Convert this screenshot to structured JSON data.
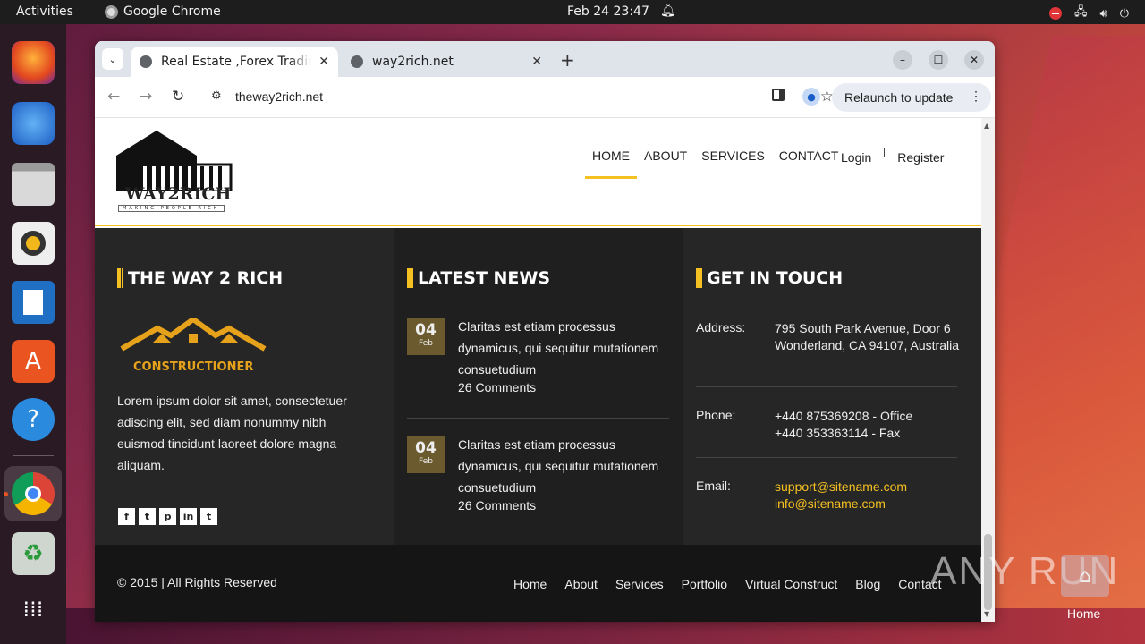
{
  "topbar": {
    "activities": "Activities",
    "app_name": "Google Chrome",
    "clock": "Feb 24  23:47"
  },
  "dock": {
    "items": [
      "firefox-icon",
      "thunderbird-icon",
      "files-icon",
      "rhythmbox-icon",
      "writer-icon",
      "app-center-icon",
      "help-icon",
      "chrome-icon",
      "trash-icon",
      "apps-grid-icon"
    ]
  },
  "browser": {
    "tabs": [
      {
        "title": "Real Estate ,Forex Trading",
        "active": true
      },
      {
        "title": "way2rich.net",
        "active": false
      }
    ],
    "url": "theway2rich.net",
    "relaunch_label": "Relaunch to update"
  },
  "site": {
    "logo_text": "WAY2RICH",
    "logo_tagline": "MAKING PEOPLE RICH",
    "nav": [
      {
        "label": "HOME",
        "active": true
      },
      {
        "label": "ABOUT",
        "active": false
      },
      {
        "label": "SERVICES",
        "active": false
      },
      {
        "label": "CONTACT",
        "active": false
      }
    ],
    "login": "Login",
    "register": "Register",
    "accent_color": "#f5c021"
  },
  "footer": {
    "col1": {
      "title": "THE WAY 2 RICH",
      "logo_name": "CONSTRUCTIONER",
      "text": "Lorem ipsum dolor sit amet, consectetuer adiscing elit, sed diam nonummy nibh euismod tincidunt laoreet dolore magna aliquam.",
      "socials": [
        "f",
        "t",
        "p",
        "in",
        "t"
      ]
    },
    "col2": {
      "title": "LATEST NEWS",
      "items": [
        {
          "day": "04",
          "month": "Feb",
          "text": "Claritas est etiam processus dynamicus, qui sequitur mutationem consuetudium",
          "comments": "26 Comments"
        },
        {
          "day": "04",
          "month": "Feb",
          "text": "Claritas est etiam processus dynamicus, qui sequitur mutationem consuetudium",
          "comments": "26 Comments"
        }
      ]
    },
    "col3": {
      "title": "GET IN TOUCH",
      "address_label": "Address:",
      "address": "795 South Park Avenue, Door 6 Wonderland, CA 94107, Australia",
      "phone_label": "Phone:",
      "phone_office": "+440 875369208 - Office",
      "phone_fax": "+440 353363114 - Fax",
      "email_label": "Email:",
      "email1": "support@sitename.com",
      "email2": "info@sitename.com"
    },
    "copyright": "© 2015 | All Rights Reserved",
    "links": [
      "Home",
      "About",
      "Services",
      "Portfolio",
      "Virtual Construct",
      "Blog",
      "Contact"
    ]
  },
  "desktop": {
    "watermark": "ANY RUN",
    "home_label": "Home"
  }
}
